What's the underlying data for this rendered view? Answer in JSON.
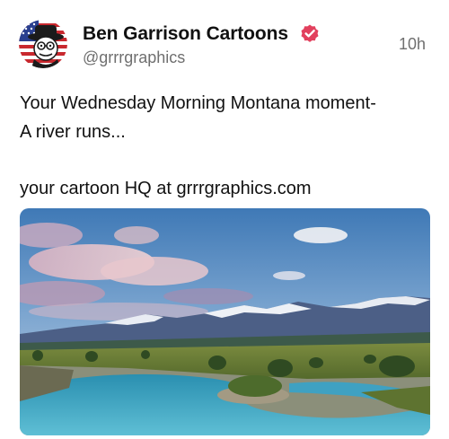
{
  "post": {
    "author": {
      "display_name": "Ben Garrison Cartoons",
      "handle": "@grrrgraphics",
      "verified_icon": "verified-badge-icon",
      "avatar_icon": "cartoon-avatar-icon"
    },
    "timestamp": "10h",
    "text_lines": [
      "Your Wednesday Morning Montana moment-",
      "A river runs...",
      "your cartoon HQ at grrrgraphics.com"
    ],
    "image": {
      "icon": "landscape-photo",
      "subject": "mountain river landscape"
    }
  },
  "colors": {
    "text_primary": "#111111",
    "text_secondary": "#6f6f6f",
    "verified_badge": "#e2405d"
  }
}
